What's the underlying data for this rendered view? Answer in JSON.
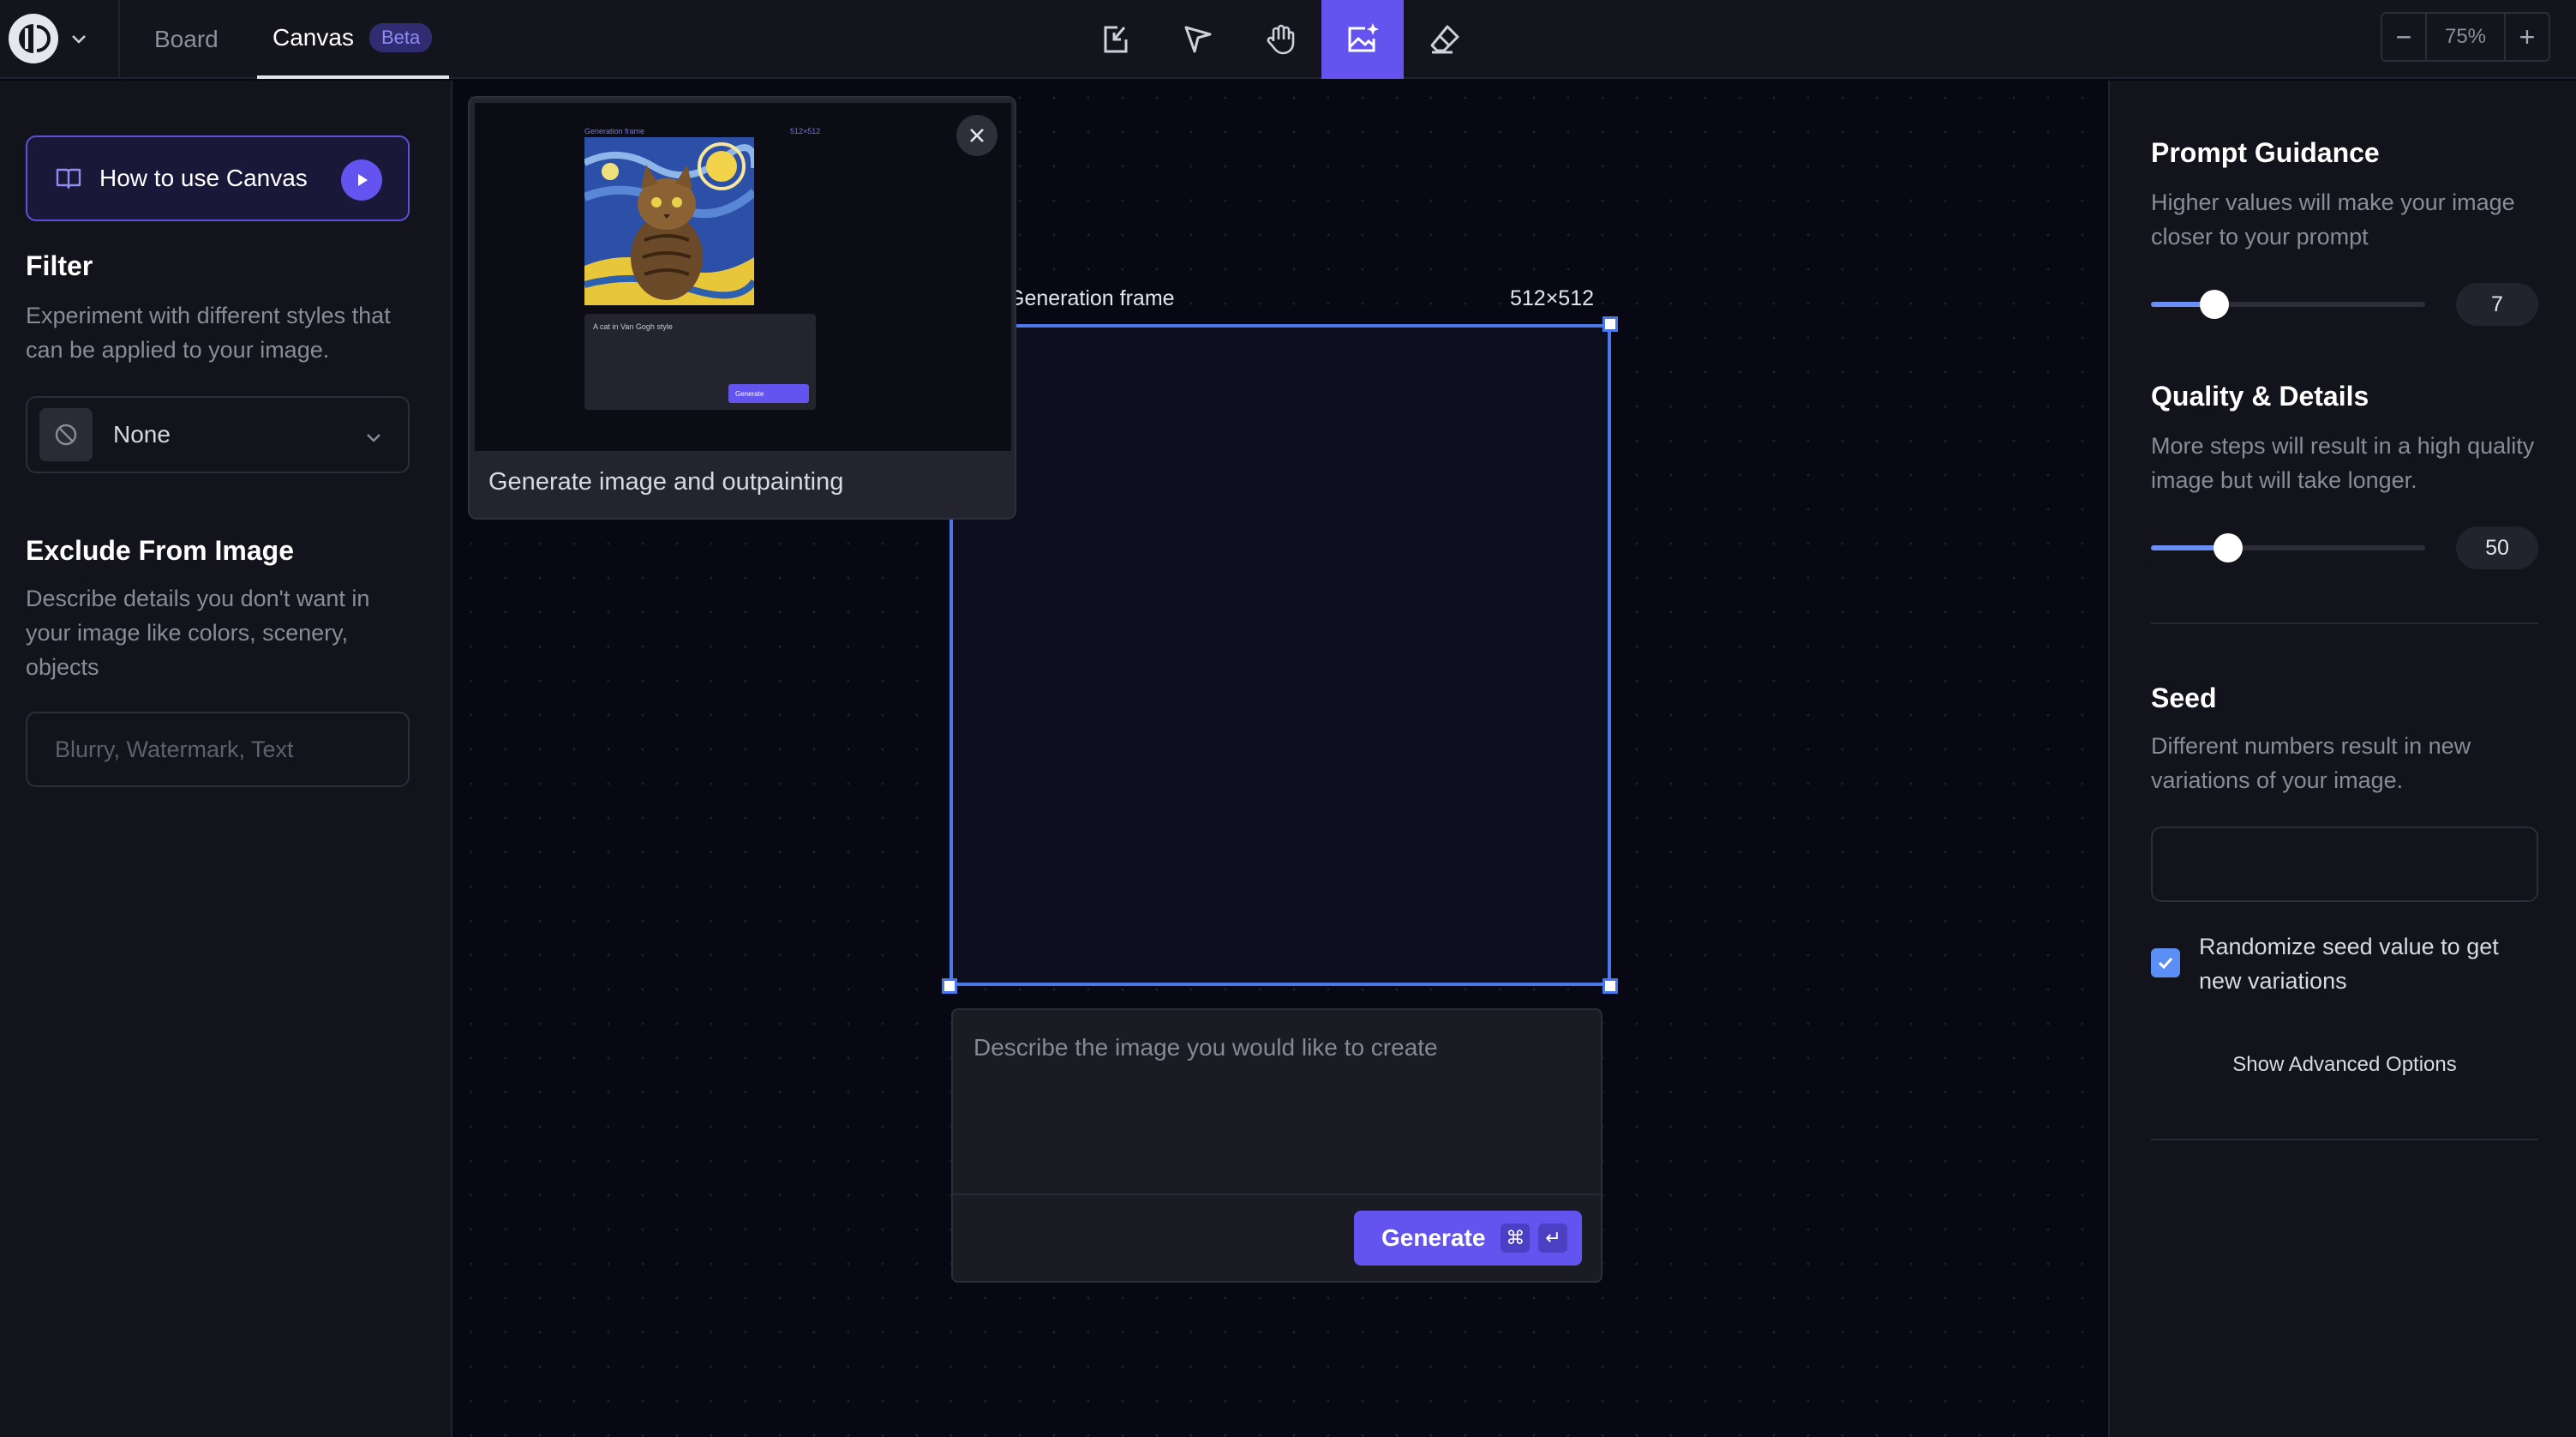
{
  "topbar": {
    "tabs": [
      {
        "label": "Board"
      },
      {
        "label": "Canvas",
        "badge": "Beta"
      }
    ],
    "tools": [
      "import-icon",
      "select-pointer-icon",
      "hand-pan-icon",
      "image-generate-icon",
      "eraser-icon"
    ],
    "zoom": {
      "minus": "−",
      "value": "75%",
      "plus": "+"
    }
  },
  "left": {
    "howto_label": "How to use Canvas",
    "filter": {
      "title": "Filter",
      "desc": "Experiment with different styles that can be applied to your image.",
      "selected": "None"
    },
    "exclude": {
      "title": "Exclude From Image",
      "desc": "Describe details you don't want in your image like colors, scenery, objects",
      "placeholder": "Blurry, Watermark, Text"
    }
  },
  "canvas": {
    "frame_label": "Generation frame",
    "frame_size": "512×512",
    "tutorial_card": {
      "title": "Generate image and outpainting",
      "mini_frame_label": "Generation frame",
      "mini_frame_size": "512×512",
      "mini_prompt": "A cat in Van Gogh style",
      "mini_button": "Generate"
    },
    "prompt_box": {
      "placeholder": "Describe the image you would like to create",
      "generate_label": "Generate",
      "kbd_cmd": "⌘",
      "kbd_enter": "↵"
    }
  },
  "right": {
    "guidance": {
      "title": "Prompt Guidance",
      "desc": "Higher values will make your image closer to your prompt",
      "value": "7",
      "fraction": 0.23
    },
    "quality": {
      "title": "Quality & Details",
      "desc": "More steps will result in a high quality image but will take longer.",
      "value": "50",
      "fraction": 0.28
    },
    "seed": {
      "title": "Seed",
      "desc": "Different numbers result in new variations of your image.",
      "value": "",
      "randomize_label": "Randomize seed value to get new variations",
      "randomize_checked": true
    },
    "advanced_label": "Show Advanced Options"
  },
  "colors": {
    "accent": "#6354f0",
    "frame_border": "#4a78e8",
    "slider_fill": "#6a8ef5"
  }
}
